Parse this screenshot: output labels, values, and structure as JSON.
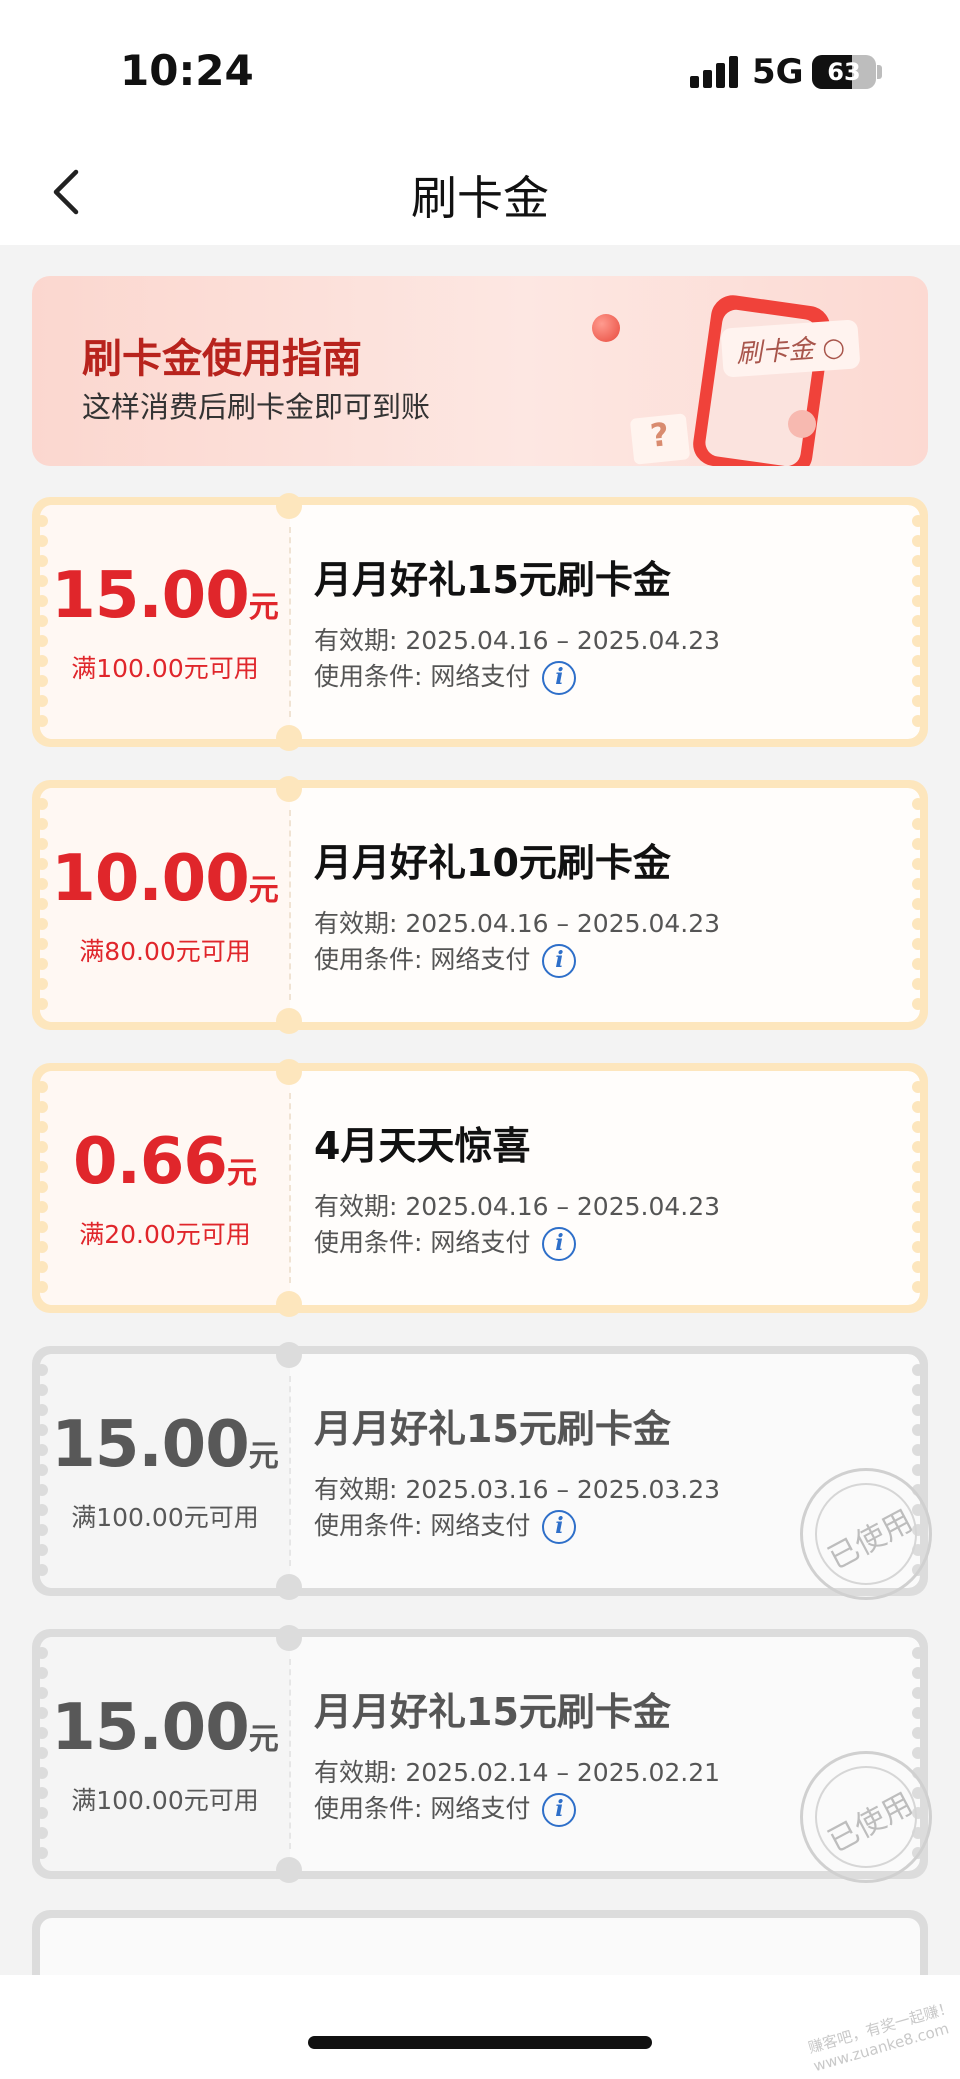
{
  "status_bar": {
    "time": "10:24",
    "network": "5G",
    "battery": "63",
    "battery_level": 0.63
  },
  "nav": {
    "title": "刷卡金"
  },
  "banner": {
    "title": "刷卡金使用指南",
    "subtitle": "这样消费后刷卡金即可到账",
    "phone_label": "刷卡金",
    "question_mark": "?"
  },
  "coupons": [
    {
      "amount": "15.00",
      "unit": "元",
      "condition": "满100.00元可用",
      "title": "月月好礼15元刷卡金",
      "validity": "有效期: 2025.04.16 – 2025.04.23",
      "usage": "使用条件:  网络支付",
      "status": "active"
    },
    {
      "amount": "10.00",
      "unit": "元",
      "condition": "满80.00元可用",
      "title": "月月好礼10元刷卡金",
      "validity": "有效期: 2025.04.16 – 2025.04.23",
      "usage": "使用条件:  网络支付",
      "status": "active"
    },
    {
      "amount": "0.66",
      "unit": "元",
      "condition": "满20.00元可用",
      "title": "4月天天惊喜",
      "validity": "有效期: 2025.04.16 – 2025.04.23",
      "usage": "使用条件:  网络支付",
      "status": "active"
    },
    {
      "amount": "15.00",
      "unit": "元",
      "condition": "满100.00元可用",
      "title": "月月好礼15元刷卡金",
      "validity": "有效期: 2025.03.16 – 2025.03.23",
      "usage": "使用条件:  网络支付",
      "status": "used",
      "stamp": "已使用"
    },
    {
      "amount": "15.00",
      "unit": "元",
      "condition": "满100.00元可用",
      "title": "月月好礼15元刷卡金",
      "validity": "有效期: 2025.02.14 – 2025.02.21",
      "usage": "使用条件:  网络支付",
      "status": "used",
      "stamp": "已使用"
    }
  ],
  "watermark": "赚客吧，有奖一起赚！ www.zuanke8.com",
  "colors": {
    "accent_red": "#e0262b",
    "active_border": "#fde6bd",
    "used_border": "#dcdcdc",
    "info_blue": "#2e6fc9"
  }
}
